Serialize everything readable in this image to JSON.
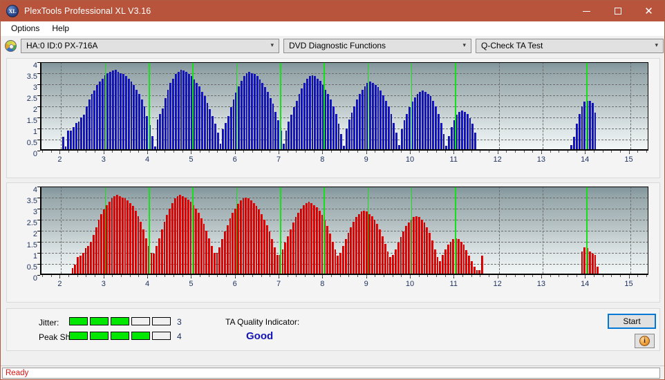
{
  "window": {
    "title": "PlexTools Professional XL V3.16",
    "app_icon": "plextools-xl-icon",
    "minimize_label": "Minimize",
    "maximize_label": "Maximize",
    "close_label": "Close"
  },
  "menu": {
    "items": [
      {
        "label": "Options"
      },
      {
        "label": "Help"
      }
    ]
  },
  "selectors": {
    "drive": {
      "value": "HA:0 ID:0  PX-716A",
      "icon": "optical-drive-icon",
      "caret": "⌄"
    },
    "function": {
      "value": "DVD Diagnostic Functions",
      "caret": "⌄"
    },
    "test": {
      "value": "Q-Check TA Test",
      "caret": "⌄"
    }
  },
  "chart_data": [
    {
      "type": "bar",
      "id": "ta-test-top",
      "title": "",
      "xlabel": "",
      "ylabel": "",
      "color": "#1516d6",
      "xlim": [
        1.55,
        15.45
      ],
      "ylim": [
        0,
        4
      ],
      "ytick_labels": [
        "0",
        "0.5",
        "1",
        "1.5",
        "2",
        "2.5",
        "3",
        "3.5",
        "4"
      ],
      "ytick_values": [
        0,
        0.5,
        1,
        1.5,
        2,
        2.5,
        3,
        3.5,
        4
      ],
      "xtick_labels": [
        "2",
        "3",
        "4",
        "5",
        "6",
        "7",
        "8",
        "9",
        "10",
        "11",
        "12",
        "13",
        "14",
        "15"
      ],
      "xtick_values": [
        2,
        3,
        4,
        5,
        6,
        7,
        8,
        9,
        10,
        11,
        12,
        13,
        14,
        15
      ],
      "grid": true,
      "markers": [
        3,
        4,
        5,
        6,
        7,
        8,
        9,
        10,
        11,
        14
      ],
      "x": [
        2.02,
        2.08,
        2.14,
        2.2,
        2.26,
        2.32,
        2.38,
        2.44,
        2.5,
        2.56,
        2.62,
        2.68,
        2.74,
        2.8,
        2.86,
        2.92,
        2.98,
        3.04,
        3.1,
        3.16,
        3.22,
        3.28,
        3.34,
        3.4,
        3.46,
        3.52,
        3.58,
        3.64,
        3.7,
        3.76,
        3.82,
        3.88,
        3.94,
        4.0,
        4.06,
        4.12,
        4.18,
        4.24,
        4.3,
        4.36,
        4.42,
        4.48,
        4.54,
        4.6,
        4.66,
        4.72,
        4.78,
        4.84,
        4.9,
        4.96,
        5.02,
        5.08,
        5.14,
        5.2,
        5.26,
        5.32,
        5.38,
        5.44,
        5.5,
        5.56,
        5.62,
        5.68,
        5.74,
        5.8,
        5.86,
        5.92,
        5.98,
        6.04,
        6.1,
        6.16,
        6.22,
        6.28,
        6.34,
        6.4,
        6.46,
        6.52,
        6.58,
        6.64,
        6.7,
        6.76,
        6.82,
        6.88,
        6.94,
        7.0,
        7.06,
        7.12,
        7.18,
        7.24,
        7.3,
        7.36,
        7.42,
        7.48,
        7.54,
        7.6,
        7.66,
        7.72,
        7.78,
        7.84,
        7.9,
        7.96,
        8.02,
        8.08,
        8.14,
        8.2,
        8.26,
        8.32,
        8.38,
        8.44,
        8.5,
        8.56,
        8.62,
        8.68,
        8.74,
        8.8,
        8.86,
        8.92,
        8.98,
        9.04,
        9.1,
        9.16,
        9.22,
        9.28,
        9.34,
        9.4,
        9.46,
        9.52,
        9.58,
        9.64,
        9.7,
        9.76,
        9.82,
        9.88,
        9.94,
        10.0,
        10.06,
        10.12,
        10.18,
        10.24,
        10.3,
        10.36,
        10.42,
        10.48,
        10.54,
        10.6,
        10.66,
        10.72,
        10.78,
        10.84,
        10.9,
        10.96,
        11.02,
        11.08,
        11.14,
        11.2,
        11.26,
        11.32,
        11.38,
        11.44,
        13.64,
        13.7,
        13.76,
        13.82,
        13.88,
        13.94,
        14.0,
        14.06,
        14.12,
        14.18
      ],
      "values": [
        0.55,
        0.12,
        0.85,
        0.85,
        1.0,
        1.2,
        1.25,
        1.45,
        1.55,
        1.95,
        2.25,
        2.5,
        2.65,
        2.9,
        3.05,
        3.2,
        3.35,
        3.45,
        3.5,
        3.55,
        3.6,
        3.5,
        3.45,
        3.4,
        3.3,
        3.2,
        3.05,
        2.9,
        2.7,
        2.5,
        2.25,
        1.95,
        1.5,
        1.1,
        0.6,
        0.12,
        1.35,
        1.6,
        1.85,
        2.3,
        2.7,
        3.0,
        3.2,
        3.4,
        3.5,
        3.6,
        3.55,
        3.5,
        3.4,
        3.3,
        3.15,
        3.0,
        2.85,
        2.6,
        2.4,
        2.1,
        1.8,
        1.5,
        1.15,
        0.75,
        0.25,
        0.9,
        1.2,
        1.5,
        1.9,
        2.25,
        2.55,
        2.85,
        3.1,
        3.3,
        3.45,
        3.5,
        3.45,
        3.4,
        3.3,
        3.15,
        3.0,
        2.8,
        2.6,
        2.3,
        2.05,
        1.7,
        1.3,
        0.85,
        0.25,
        0.85,
        1.25,
        1.55,
        1.9,
        2.2,
        2.5,
        2.75,
        3.0,
        3.2,
        3.3,
        3.35,
        3.3,
        3.2,
        3.1,
        2.9,
        2.7,
        2.5,
        2.25,
        1.95,
        1.6,
        1.15,
        0.7,
        0.15,
        0.95,
        1.35,
        1.65,
        1.95,
        2.25,
        2.5,
        2.7,
        2.85,
        3.0,
        3.05,
        3.0,
        2.9,
        2.8,
        2.65,
        2.45,
        2.2,
        1.95,
        1.6,
        1.2,
        0.75,
        0.2,
        0.9,
        1.3,
        1.6,
        1.9,
        2.15,
        2.35,
        2.5,
        2.6,
        2.65,
        2.6,
        2.5,
        2.4,
        2.2,
        1.95,
        1.6,
        1.2,
        0.7,
        0.15,
        0.6,
        1.0,
        1.3,
        1.55,
        1.7,
        1.75,
        1.7,
        1.6,
        1.4,
        1.15,
        0.75,
        0.2,
        0.55,
        1.15,
        1.6,
        1.95,
        2.15,
        2.2,
        2.2,
        2.1,
        1.65,
        0.6
      ]
    },
    {
      "type": "bar",
      "id": "ta-test-bottom",
      "title": "",
      "xlabel": "",
      "ylabel": "",
      "color": "#f80000",
      "xlim": [
        1.55,
        15.45
      ],
      "ylim": [
        0,
        4
      ],
      "ytick_labels": [
        "0",
        "0.5",
        "1",
        "1.5",
        "2",
        "2.5",
        "3",
        "3.5",
        "4"
      ],
      "ytick_values": [
        0,
        0.5,
        1,
        1.5,
        2,
        2.5,
        3,
        3.5,
        4
      ],
      "xtick_labels": [
        "2",
        "3",
        "4",
        "5",
        "6",
        "7",
        "8",
        "9",
        "10",
        "11",
        "12",
        "13",
        "14",
        "15"
      ],
      "xtick_values": [
        2,
        3,
        4,
        5,
        6,
        7,
        8,
        9,
        10,
        11,
        12,
        13,
        14,
        15
      ],
      "grid": true,
      "markers": [
        3,
        4,
        5,
        6,
        7,
        8,
        9,
        10,
        11,
        14
      ],
      "x": [
        2.24,
        2.3,
        2.36,
        2.42,
        2.48,
        2.54,
        2.6,
        2.66,
        2.72,
        2.78,
        2.84,
        2.9,
        2.96,
        3.02,
        3.08,
        3.14,
        3.2,
        3.26,
        3.32,
        3.38,
        3.44,
        3.5,
        3.56,
        3.62,
        3.68,
        3.74,
        3.8,
        3.86,
        3.92,
        3.98,
        4.04,
        4.1,
        4.16,
        4.22,
        4.28,
        4.34,
        4.4,
        4.46,
        4.52,
        4.58,
        4.64,
        4.7,
        4.76,
        4.82,
        4.88,
        4.94,
        5.0,
        5.06,
        5.12,
        5.18,
        5.24,
        5.3,
        5.36,
        5.42,
        5.48,
        5.54,
        5.6,
        5.66,
        5.72,
        5.78,
        5.84,
        5.9,
        5.96,
        6.02,
        6.08,
        6.14,
        6.2,
        6.26,
        6.32,
        6.38,
        6.44,
        6.5,
        6.56,
        6.62,
        6.68,
        6.74,
        6.8,
        6.86,
        6.92,
        6.98,
        7.04,
        7.1,
        7.16,
        7.22,
        7.28,
        7.34,
        7.4,
        7.46,
        7.52,
        7.58,
        7.64,
        7.7,
        7.76,
        7.82,
        7.88,
        7.94,
        8.0,
        8.06,
        8.12,
        8.18,
        8.24,
        8.3,
        8.36,
        8.42,
        8.48,
        8.54,
        8.6,
        8.66,
        8.72,
        8.78,
        8.84,
        8.9,
        8.96,
        9.02,
        9.08,
        9.14,
        9.2,
        9.26,
        9.32,
        9.38,
        9.44,
        9.5,
        9.56,
        9.62,
        9.68,
        9.74,
        9.8,
        9.86,
        9.92,
        9.98,
        10.04,
        10.1,
        10.16,
        10.22,
        10.28,
        10.34,
        10.4,
        10.46,
        10.52,
        10.58,
        10.64,
        10.7,
        10.76,
        10.82,
        10.88,
        10.94,
        11.0,
        11.06,
        11.12,
        11.18,
        11.24,
        11.3,
        11.36,
        11.42,
        11.48,
        11.54,
        11.6,
        13.88,
        13.94,
        14.0,
        14.06,
        14.12,
        14.18,
        14.24,
        14.3
      ],
      "values": [
        0.25,
        0.4,
        0.75,
        0.8,
        0.95,
        1.15,
        1.25,
        1.45,
        1.75,
        2.1,
        2.45,
        2.7,
        2.9,
        3.1,
        3.25,
        3.4,
        3.5,
        3.55,
        3.5,
        3.45,
        3.4,
        3.3,
        3.2,
        3.05,
        2.85,
        2.6,
        2.35,
        2.0,
        1.6,
        1.25,
        0.95,
        0.9,
        1.25,
        1.6,
        2.0,
        2.35,
        2.65,
        2.95,
        3.2,
        3.4,
        3.5,
        3.55,
        3.5,
        3.45,
        3.35,
        3.25,
        3.1,
        2.95,
        2.75,
        2.5,
        2.25,
        1.95,
        1.6,
        1.25,
        0.95,
        0.95,
        1.2,
        1.55,
        1.9,
        2.2,
        2.5,
        2.75,
        2.95,
        3.15,
        3.3,
        3.4,
        3.45,
        3.4,
        3.3,
        3.2,
        3.05,
        2.9,
        2.7,
        2.45,
        2.2,
        1.9,
        1.55,
        1.2,
        0.85,
        0.85,
        1.1,
        1.4,
        1.7,
        2.0,
        2.3,
        2.55,
        2.75,
        2.95,
        3.1,
        3.2,
        3.25,
        3.2,
        3.1,
        3.0,
        2.85,
        2.65,
        2.4,
        2.15,
        1.8,
        1.45,
        1.1,
        0.8,
        0.95,
        1.25,
        1.55,
        1.85,
        2.1,
        2.35,
        2.55,
        2.7,
        2.8,
        2.85,
        2.8,
        2.7,
        2.6,
        2.45,
        2.25,
        2.0,
        1.7,
        1.35,
        1.0,
        0.75,
        0.85,
        1.1,
        1.4,
        1.65,
        1.9,
        2.15,
        2.3,
        2.45,
        2.55,
        2.6,
        2.55,
        2.45,
        2.3,
        2.1,
        1.85,
        1.5,
        1.1,
        0.75,
        0.55,
        0.85,
        1.1,
        1.3,
        1.45,
        1.55,
        1.6,
        1.55,
        1.45,
        1.3,
        1.05,
        0.8,
        0.55,
        0.3,
        0.15,
        0.15,
        0.8,
        1.0,
        1.2,
        1.15,
        1.0,
        0.9,
        0.85,
        0.3
      ]
    }
  ],
  "results": {
    "jitter": {
      "label": "Jitter:",
      "value": 3,
      "max": 5
    },
    "peak_shift": {
      "label": "Peak Shift:",
      "value": 4,
      "max": 5
    },
    "quality": {
      "label": "TA Quality Indicator:",
      "value": "Good",
      "color": "#1414b4"
    },
    "start_button": "Start",
    "info_button": "info-icon"
  },
  "status": {
    "text": "Ready"
  }
}
